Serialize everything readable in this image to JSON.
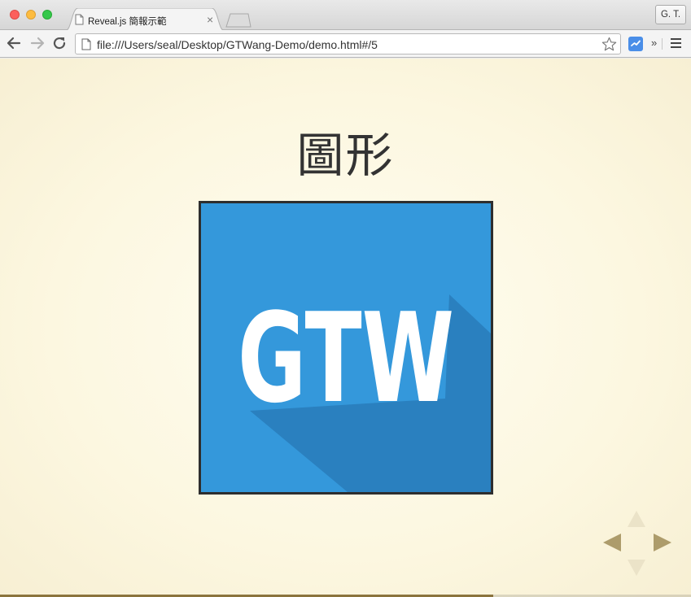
{
  "window": {
    "profile_label": "G. T."
  },
  "tab": {
    "title": "Reveal.js 簡報示範",
    "close_glyph": "×"
  },
  "toolbar": {
    "url": "file:///Users/seal/Desktop/GTWang-Demo/demo.html#/5",
    "overflow_glyph": "»"
  },
  "slide": {
    "title": "圖形",
    "image_text": "GTW",
    "image_bg_color": "#3498db",
    "image_shadow_color": "#2a80bf"
  },
  "progress": {
    "fraction": 0.714
  },
  "colors": {
    "background": "#fcf7e0",
    "controls_active": "#ad9c6b",
    "controls_inactive": "#ebe3c8",
    "progress": "#8b743d"
  }
}
